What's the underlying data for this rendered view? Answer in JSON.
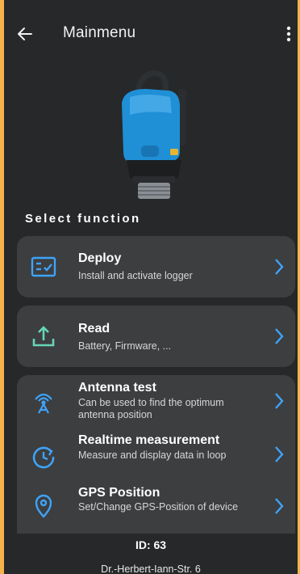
{
  "header": {
    "title": "Mainmenu",
    "back_icon": "arrow-left-icon",
    "menu_icon": "more-vertical-icon"
  },
  "device_image": "logger-device-icon",
  "section_title": "Select function",
  "menu": [
    {
      "label": "Deploy",
      "description": "Install and activate logger",
      "icon": "deploy-icon"
    },
    {
      "label": "Read",
      "description": "Battery, Firmware, ...",
      "icon": "upload-icon"
    },
    {
      "label": "Antenna test",
      "description": "Can be used to find the optimum antenna position",
      "icon": "antenna-icon"
    },
    {
      "label": "Realtime measurement",
      "description": "Measure and display data in loop",
      "icon": "realtime-icon"
    },
    {
      "label": "GPS Position",
      "description": "Set/Change GPS-Position of device",
      "icon": "location-pin-icon"
    }
  ],
  "footer": {
    "id_text": "ID: 63",
    "address": "Dr.-Herbert-Iann-Str. 6"
  },
  "colors": {
    "background": "#26282a",
    "card": "#3c3e40",
    "accent_blue": "#3fa3f7",
    "accent_teal": "#67d4b7",
    "outer_border": "#f3b24a"
  }
}
